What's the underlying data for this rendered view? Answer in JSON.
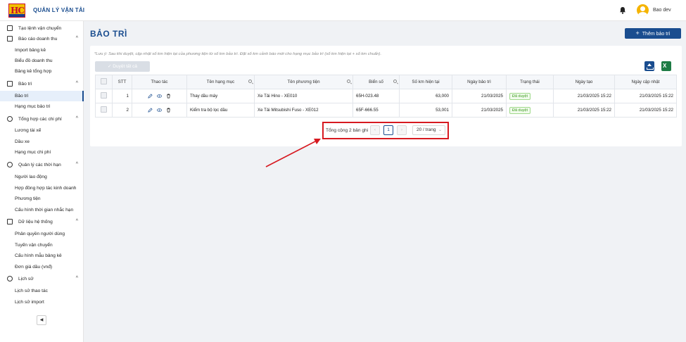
{
  "app": {
    "title": "QUẢN LÝ VẬN TẢI",
    "logo_text": "HC",
    "user": "Bao dev"
  },
  "sidebar": {
    "items": [
      {
        "label": "Tạo lệnh vận chuyển",
        "level": 0,
        "icon": "upload-box-icon"
      },
      {
        "label": "Báo cáo doanh thu",
        "level": 0,
        "icon": "bar-chart-icon",
        "expanded": true
      },
      {
        "label": "Import bảng kê",
        "level": 1
      },
      {
        "label": "Biểu đồ doanh thu",
        "level": 1
      },
      {
        "label": "Bảng kê tổng hợp",
        "level": 1
      },
      {
        "label": "Bảo trì",
        "level": 0,
        "icon": "wrench-icon",
        "expanded": true
      },
      {
        "label": "Bảo trì",
        "level": 1,
        "active": true
      },
      {
        "label": "Hạng mục bảo trì",
        "level": 1
      },
      {
        "label": "Tổng hợp các chi phí",
        "level": 0,
        "icon": "dollar-icon",
        "expanded": true
      },
      {
        "label": "Lương tài xế",
        "level": 1
      },
      {
        "label": "Dầu xe",
        "level": 1
      },
      {
        "label": "Hạng mục chi phí",
        "level": 1
      },
      {
        "label": "Quản lý các thời hạn",
        "level": 0,
        "icon": "clock-icon",
        "expanded": true
      },
      {
        "label": "Người lao động",
        "level": 1
      },
      {
        "label": "Hợp đồng hợp tác kinh doanh",
        "level": 1
      },
      {
        "label": "Phương tiện",
        "level": 1
      },
      {
        "label": "Cấu hình thời gian nhắc hạn",
        "level": 1
      },
      {
        "label": "Dữ liệu hệ thống",
        "level": 0,
        "icon": "database-icon",
        "expanded": true
      },
      {
        "label": "Phân quyền người dùng",
        "level": 1
      },
      {
        "label": "Tuyến vận chuyển",
        "level": 1
      },
      {
        "label": "Cấu hình mẫu bảng kê",
        "level": 1
      },
      {
        "label": "Đơn giá dầu (vnđ)",
        "level": 1
      },
      {
        "label": "Lịch sử",
        "level": 0,
        "icon": "history-icon",
        "expanded": true
      },
      {
        "label": "Lịch sử thao tác",
        "level": 1
      },
      {
        "label": "Lịch sử import",
        "level": 1
      }
    ]
  },
  "page": {
    "title": "BẢO TRÌ",
    "add_button": "Thêm bảo trì",
    "note": "*Lưu ý: Sau khi duyệt, cập nhật số km hiện tại của phương tiện từ số km bảo trì. Đặt số km cảnh báo mới cho hạng mục bảo trì (số km hiện tại + số km chuẩn).",
    "approve_all": "Duyệt tất cả"
  },
  "table": {
    "headers": [
      "STT",
      "Thao tác",
      "Tên hạng mục",
      "Tên phương tiện",
      "Biển số",
      "Số km hiện tại",
      "Ngày bảo trì",
      "Trạng thái",
      "Ngày tạo",
      "Ngày cập nhật"
    ],
    "rows": [
      {
        "stt": "1",
        "item": "Thay dầu máy",
        "vehicle": "Xe Tải Hino - XE010",
        "plate": "65H-023.48",
        "km": "63,000",
        "date": "21/03/2025",
        "status": "Đã duyệt",
        "created": "21/03/2025 15:22",
        "updated": "21/03/2025 15:22"
      },
      {
        "stt": "2",
        "item": "Kiểm tra bộ lọc dầu",
        "vehicle": "Xe Tải Mitsubishi Fuso - XE012",
        "plate": "65F-666.55",
        "km": "53,001",
        "date": "21/03/2025",
        "status": "Đã duyệt",
        "created": "21/03/2025 15:22",
        "updated": "21/03/2025 15:22"
      }
    ]
  },
  "pagination": {
    "total_label": "Tổng cộng 2 bản ghi",
    "current_page": "1",
    "page_size": "20 / trang"
  },
  "colors": {
    "primary": "#1a4d8f",
    "highlight": "#d71920",
    "success": "#3c9b1f"
  }
}
